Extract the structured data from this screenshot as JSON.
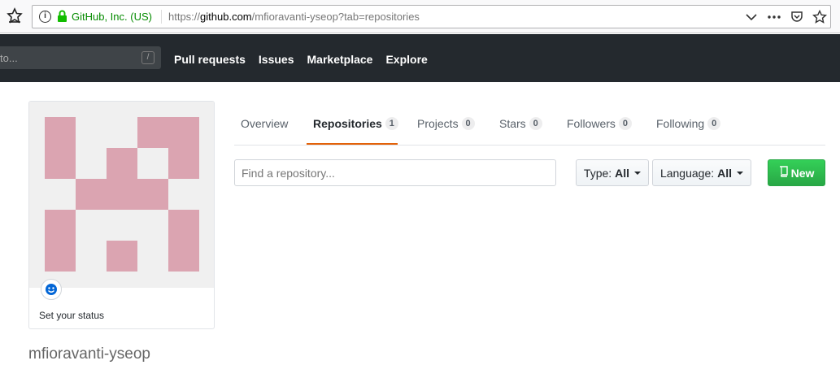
{
  "browser": {
    "identity": "GitHub, Inc. (US)",
    "url_prefix": "https://",
    "url_host": "github.com",
    "url_path": "/mfioravanti-yseop?tab=repositories"
  },
  "header": {
    "search_placeholder": "to...",
    "search_shortcut": "/",
    "nav": [
      "Pull requests",
      "Issues",
      "Marketplace",
      "Explore"
    ]
  },
  "profile": {
    "status_label": "Set your status",
    "username": "mfioravanti-yseop",
    "avatar_color": "#dba4b1"
  },
  "tabs": [
    {
      "label": "Overview",
      "count": null
    },
    {
      "label": "Repositories",
      "count": "1",
      "selected": true
    },
    {
      "label": "Projects",
      "count": "0"
    },
    {
      "label": "Stars",
      "count": "0"
    },
    {
      "label": "Followers",
      "count": "0"
    },
    {
      "label": "Following",
      "count": "0"
    }
  ],
  "filters": {
    "search_placeholder": "Find a repository...",
    "type_label": "Type:",
    "type_value": "All",
    "language_label": "Language:",
    "language_value": "All",
    "new_label": "New"
  }
}
